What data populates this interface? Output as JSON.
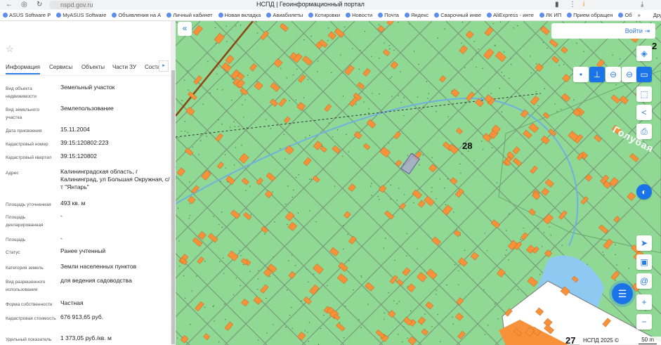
{
  "browser": {
    "url": "nspd.gov.ru",
    "title": "НСПД | Геоинформационный портал",
    "bookmarks": [
      "ASUS Software P",
      "MyASUS Software",
      "Объявления на А",
      "Личный кабинет",
      "Новая вкладка",
      "Авиабилеты",
      "Котировки",
      "Новости",
      "Почта",
      "Яндекс",
      "Сварочный инве",
      "AliExpress - инте",
      "ЛК ИП",
      "Прием обращен",
      "Об"
    ],
    "more": "»",
    "other_bookmarks": "Другие закладки"
  },
  "panel": {
    "tabs": [
      "Информация",
      "Сервисы",
      "Объекты",
      "Части ЗУ",
      "Соста"
    ],
    "fields": [
      {
        "label": "Вид объекта недвижимости",
        "value": "Земельный участок"
      },
      {
        "label": "Вид земельного участка",
        "value": "Землепользование"
      },
      {
        "label": "Дата присвоения",
        "value": "15.11.2004"
      },
      {
        "label": "Кадастровый номер",
        "value": "39:15:120802:223"
      },
      {
        "label": "Кадастровый квартал",
        "value": "39:15:120802"
      },
      {
        "label": "Адрес",
        "value": "Калининградская область, г Калининград, ул Большая Окружная, с/т \"Янтарь\""
      },
      {
        "label": "Площадь уточненная",
        "value": "493 кв. м"
      },
      {
        "label": "Площадь декларированная",
        "value": "-"
      },
      {
        "label": "Площадь",
        "value": "-"
      },
      {
        "label": "Статус",
        "value": "Ранее учтенный"
      },
      {
        "label": "Категория земель",
        "value": "Земли населенных пунктов"
      },
      {
        "label": "Вид разрешенного использования",
        "value": "для ведения садоводства"
      },
      {
        "label": "Форма собственности",
        "value": "Частная"
      },
      {
        "label": "Кадастровая стоимость",
        "value": "676 913,65 руб."
      },
      {
        "label": "Удельный показатель кадастровой стоимости",
        "value": "1 373,05 руб./кв. м"
      }
    ]
  },
  "map": {
    "login": "Войти",
    "labels": [
      "28",
      "27",
      "2",
      "Голубая"
    ],
    "attribution": "НСПД 2025 ©",
    "scale": "50 m",
    "colors": {
      "land": "#8fd994",
      "house": "#f7923a",
      "water": "#8ec9f2",
      "accent": "#1a73e8"
    }
  }
}
